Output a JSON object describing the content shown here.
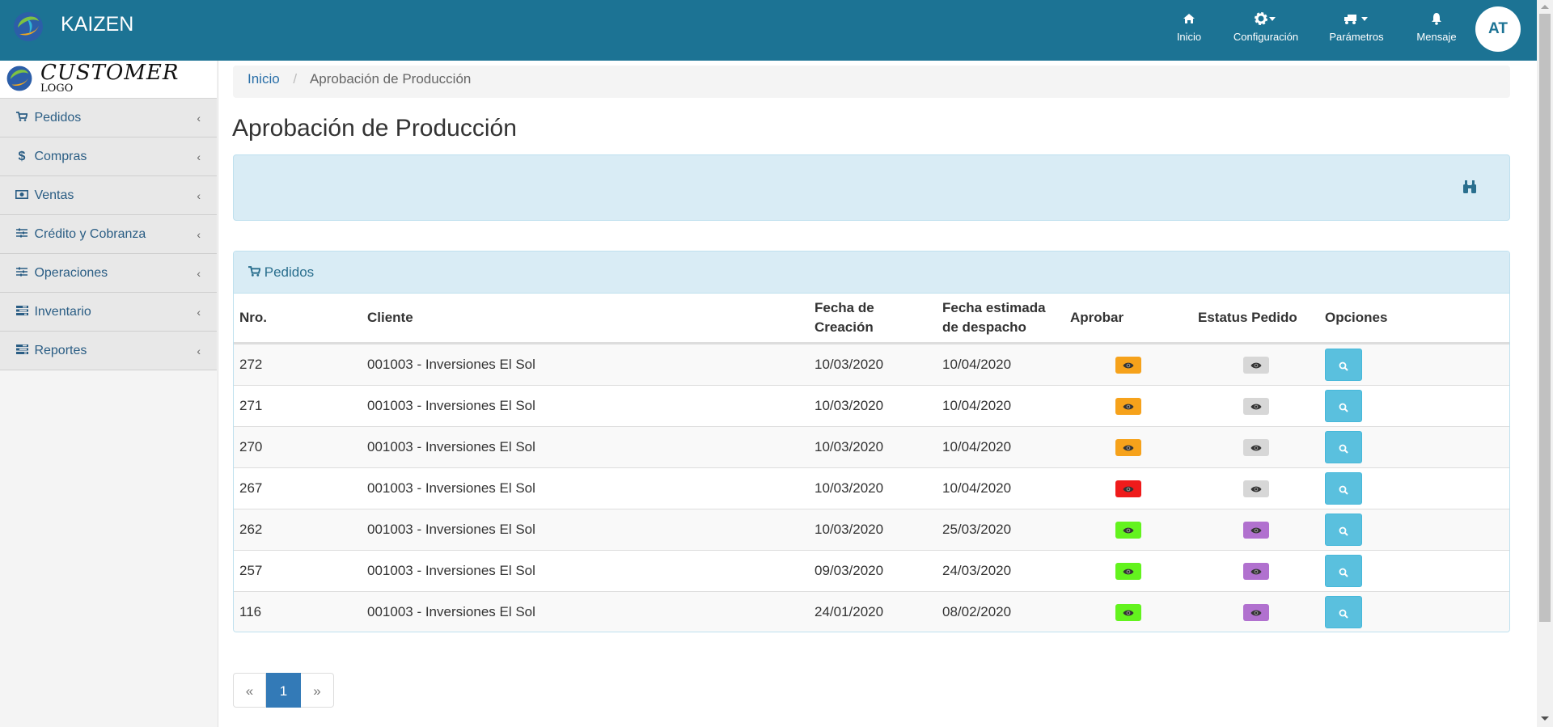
{
  "app": {
    "brand": "KAIZEN",
    "customer_logo_main": "CUSTOMER",
    "customer_logo_sub": "LOGO"
  },
  "topnav": [
    {
      "label": "Inicio",
      "icon": "home-icon"
    },
    {
      "label": "Configuración",
      "icon": "gear-icon"
    },
    {
      "label": "Parámetros",
      "icon": "truck-icon"
    },
    {
      "label": "Mensaje",
      "icon": "bell-icon"
    }
  ],
  "user": {
    "initials": "AT"
  },
  "sidebar": {
    "items": [
      {
        "label": "Pedidos",
        "icon": "cart-icon"
      },
      {
        "label": "Compras",
        "icon": "dollar-icon"
      },
      {
        "label": "Ventas",
        "icon": "money-icon"
      },
      {
        "label": "Crédito y Cobranza",
        "icon": "sliders-icon"
      },
      {
        "label": "Operaciones",
        "icon": "sliders-icon"
      },
      {
        "label": "Inventario",
        "icon": "tasks-icon"
      },
      {
        "label": "Reportes",
        "icon": "tasks-icon"
      }
    ]
  },
  "breadcrumb": {
    "home": "Inicio",
    "current": "Aprobación de Producción"
  },
  "page": {
    "title": "Aprobación de Producción"
  },
  "panel": {
    "title": "Pedidos"
  },
  "table": {
    "headers": [
      "Nro.",
      "Cliente",
      "Fecha de Creación",
      "Fecha estimada de despacho",
      "Aprobar",
      "Estatus Pedido",
      "Opciones"
    ],
    "rows": [
      {
        "nro": "272",
        "cliente": "001003 - Inversiones El Sol",
        "creacion": "10/03/2020",
        "despacho": "10/04/2020",
        "aprobar_color": "#f6a21b",
        "estatus_color": "#d7d7d7"
      },
      {
        "nro": "271",
        "cliente": "001003 - Inversiones El Sol",
        "creacion": "10/03/2020",
        "despacho": "10/04/2020",
        "aprobar_color": "#f6a21b",
        "estatus_color": "#d7d7d7"
      },
      {
        "nro": "270",
        "cliente": "001003 - Inversiones El Sol",
        "creacion": "10/03/2020",
        "despacho": "10/04/2020",
        "aprobar_color": "#f6a21b",
        "estatus_color": "#d7d7d7"
      },
      {
        "nro": "267",
        "cliente": "001003 - Inversiones El Sol",
        "creacion": "10/03/2020",
        "despacho": "10/04/2020",
        "aprobar_color": "#ef1b1b",
        "estatus_color": "#d7d7d7"
      },
      {
        "nro": "262",
        "cliente": "001003 - Inversiones El Sol",
        "creacion": "10/03/2020",
        "despacho": "25/03/2020",
        "aprobar_color": "#63f31e",
        "estatus_color": "#b171cf"
      },
      {
        "nro": "257",
        "cliente": "001003 - Inversiones El Sol",
        "creacion": "09/03/2020",
        "despacho": "24/03/2020",
        "aprobar_color": "#63f31e",
        "estatus_color": "#b171cf"
      },
      {
        "nro": "116",
        "cliente": "001003 - Inversiones El Sol",
        "creacion": "24/01/2020",
        "despacho": "08/02/2020",
        "aprobar_color": "#63f31e",
        "estatus_color": "#b171cf"
      }
    ]
  },
  "pagination": {
    "prev": "«",
    "current": "1",
    "next": "»"
  },
  "colors": {
    "topbar": "#1c7394",
    "panel": "#d9ecf5",
    "button": "#5ac0de",
    "active_page": "#337ab7"
  }
}
